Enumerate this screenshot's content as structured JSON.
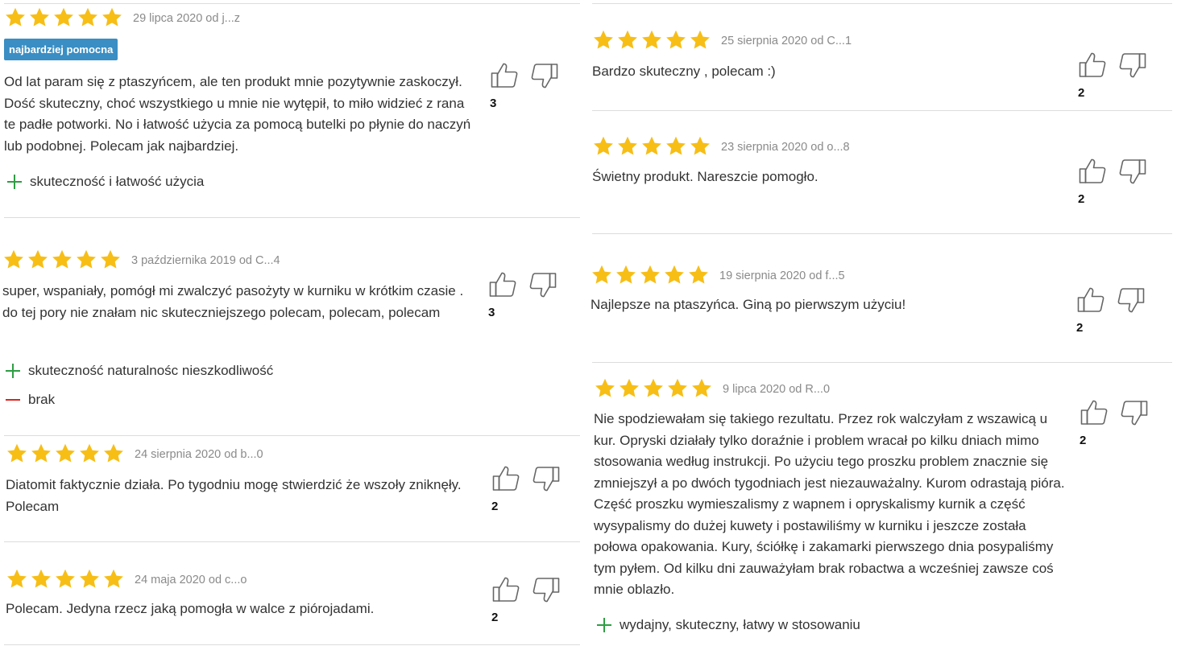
{
  "colors": {
    "star": "#f7be16",
    "badge": "#3a8ec3",
    "plus": "#2e9e43",
    "minus": "#e0231c",
    "divider": "#dcdcdc",
    "date": "#8a8a8a"
  },
  "icons": {
    "star": "star-icon",
    "up": "thumbs-up-icon",
    "down": "thumbs-down-icon",
    "pro": "plus-icon",
    "con": "minus-icon"
  },
  "reviews": [
    {
      "rating": 5,
      "date": "29 lipca 2020 od j...z",
      "badge": "najbardziej pomocna",
      "text": "Od lat param się z ptaszyńcem, ale ten produkt mnie pozytywnie zaskoczył. Dość skuteczny, choć wszystkiego u mnie nie wytępił, to miło widzieć z rana te padłe potworki. No i łatwość użycia za pomocą butelki po płynie do naczyń lub podobnej. Polecam jak najbardziej.",
      "pros": "skuteczność i łatwość użycia",
      "votes": "3"
    },
    {
      "rating": 5,
      "date": "3 października 2019 od C...4",
      "text": "super, wspaniały, pomógł mi zwalczyć pasożyty w kurniku w krótkim czasie . do tej pory nie znałam nic skuteczniejszego polecam, polecam, polecam",
      "pros": "skuteczność naturalnośc nieszkodliwość",
      "cons": "brak",
      "votes": "3"
    },
    {
      "rating": 5,
      "date": "24 sierpnia 2020 od b...0",
      "text": "Diatomit faktycznie działa. Po tygodniu mogę stwierdzić że wszoły zniknęły. Polecam",
      "votes": "2"
    },
    {
      "rating": 5,
      "date": "24 maja 2020 od c...o",
      "text": "Polecam. Jedyna rzecz jaką pomogła w walce z piórojadami.",
      "votes": "2"
    },
    {
      "rating": 5,
      "date": "25 sierpnia 2020 od C...1",
      "text": "Bardzo skuteczny , polecam :)",
      "votes": "2"
    },
    {
      "rating": 5,
      "date": "23 sierpnia 2020 od o...8",
      "text": "Świetny produkt. Nareszcie pomogło.",
      "votes": "2"
    },
    {
      "rating": 5,
      "date": "19 sierpnia 2020 od f...5",
      "text": "Najlepsze na ptaszyńca. Giną po pierwszym użyciu!",
      "votes": "2"
    },
    {
      "rating": 5,
      "date": "9 lipca 2020 od R...0",
      "text": "Nie spodziewałam się takiego rezultatu. Przez rok walczyłam z wszawicą u kur. Opryski działały tylko doraźnie i problem wracał po kilku dniach mimo stosowania według instrukcji. Po użyciu tego proszku problem znacznie się zmniejszył a po dwóch tygodniach jest niezauważalny. Kurom odrastają pióra. Część proszku wymieszalismy z wapnem i opryskalismy kurnik a część wysypalismy do dużej kuwety i postawiliśmy w kurniku i jeszcze została połowa opakowania. Kury, ściółkę i zakamarki pierwszego dnia posypaliśmy tym pyłem. Od kilku dni zauważyłam brak robactwa a wcześniej zawsze coś mnie oblazło.",
      "pros": "wydajny, skuteczny, łatwy w stosowaniu",
      "votes": "2"
    }
  ]
}
